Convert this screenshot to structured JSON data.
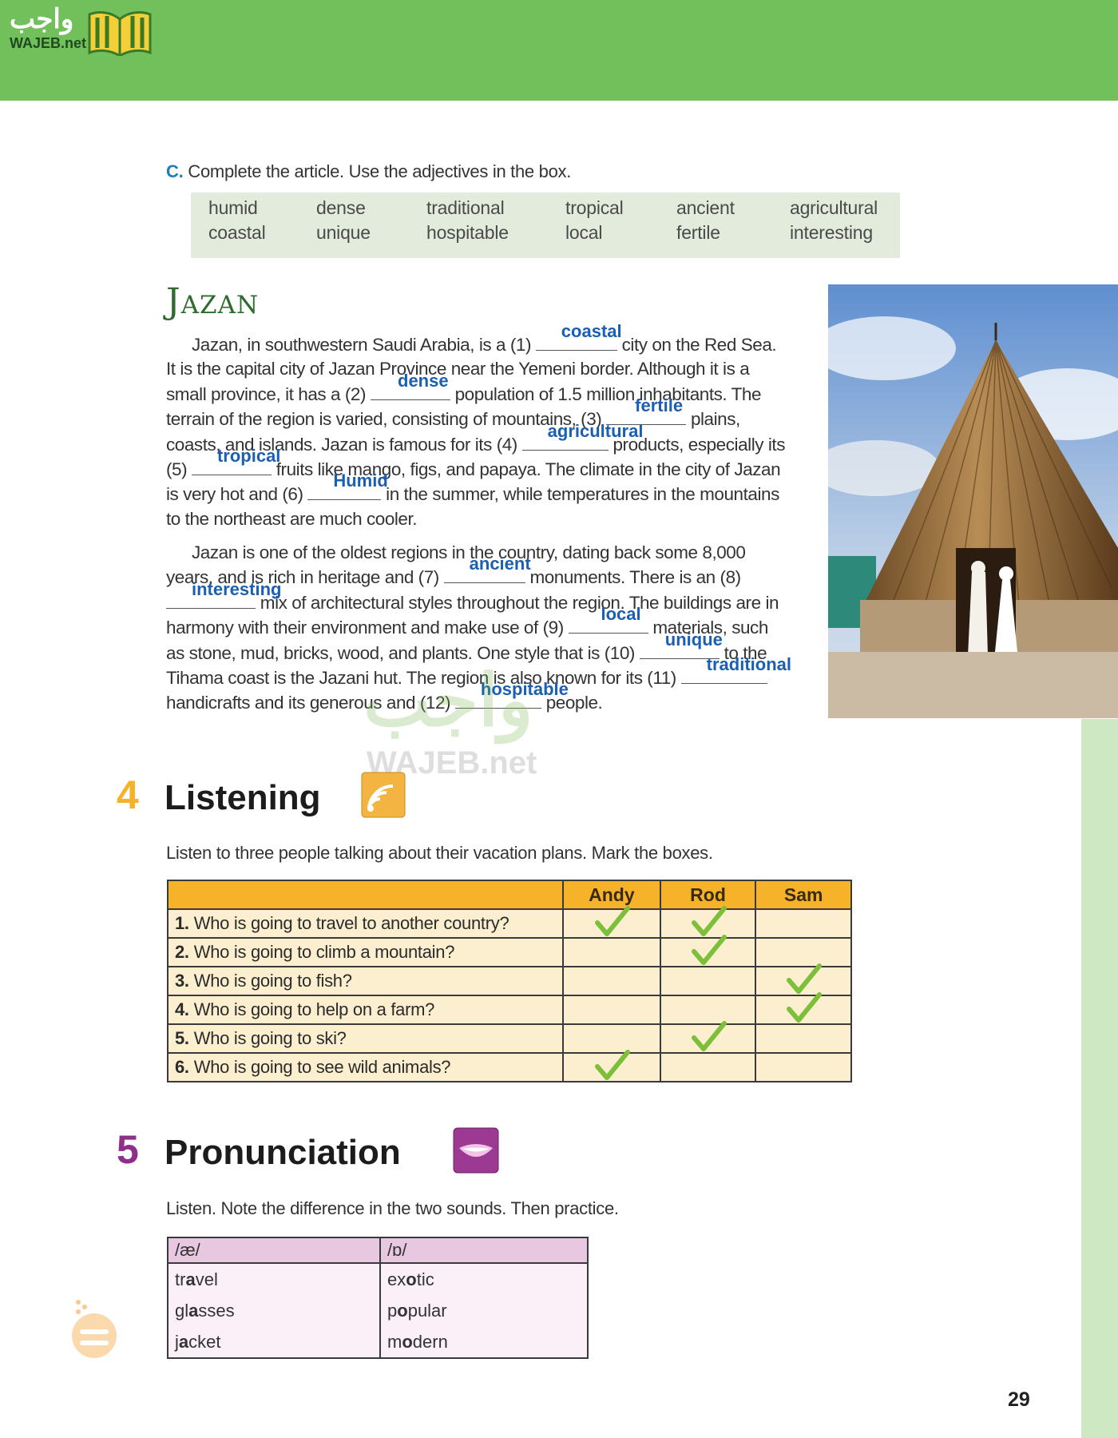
{
  "logo": {
    "arabic": "واجب",
    "english": "WAJEB.net"
  },
  "watermark": {
    "arabic": "واجب",
    "english": "WAJEB.net"
  },
  "section_c": {
    "letter": "C.",
    "instruction": "Complete the article. Use the adjectives in the box.",
    "word_box": [
      [
        "humid",
        "coastal"
      ],
      [
        "dense",
        "unique"
      ],
      [
        "traditional",
        "hospitable"
      ],
      [
        "tropical",
        "local"
      ],
      [
        "ancient",
        "fertile"
      ],
      [
        "agricultural",
        "interesting"
      ]
    ]
  },
  "article": {
    "title": "Jazan",
    "p1": {
      "t1": "Jazan, in southwestern Saudi Arabia, is a (1) ",
      "a1": "coastal",
      "t2": " city on the Red Sea. It is the capital city of Jazan Province near the Yemeni border. Although it is a small province, it has a (2) ",
      "a2": "dense",
      "t3": " population of 1.5 million inhabitants. The terrain of the region is varied, consisting of mountains, (3) ",
      "a3": "fertile",
      "t4": " plains, coasts, and islands. Jazan is famous for its (4) ",
      "a4": "agricultural",
      "t5": " products, especially its (5) ",
      "a5": "tropical",
      "t6": " fruits like mango, figs, and papaya. The climate in the city of Jazan is very hot and (6) ",
      "a6": "Humid",
      "t7": " in the summer, while temperatures in the mountains to the northeast are much cooler."
    },
    "p2": {
      "t1": "Jazan is one of the oldest regions in the country, dating back some 8,000 years, and is rich in heritage and (7) ",
      "a7": "ancient",
      "t2": " monuments. There is an (8) ",
      "a8": "interesting",
      "t3": " mix of architectural styles throughout the region. The buildings are in harmony with their environment and make use of (9) ",
      "a9": "local",
      "t4": " materials, such as stone, mud, bricks, wood, and plants. One style that is (10) ",
      "a10": "unique",
      "t5": " to the Tihama coast is the Jazani hut. The region is also known for its (11) ",
      "a11": "traditional",
      "t6": " handicrafts and its generous and (12) ",
      "a12": "hospitable",
      "t7": " people."
    }
  },
  "listening": {
    "number": "4",
    "title": "Listening",
    "instruction": "Listen to three people talking about their vacation plans. Mark the boxes.",
    "columns": [
      "Andy",
      "Rod",
      "Sam"
    ],
    "rows": [
      {
        "num": "1.",
        "question": "Who is going to travel to another country?",
        "marks": [
          true,
          true,
          false
        ]
      },
      {
        "num": "2.",
        "question": "Who is going to climb a mountain?",
        "marks": [
          false,
          true,
          false
        ]
      },
      {
        "num": "3.",
        "question": "Who is going to fish?",
        "marks": [
          false,
          false,
          true
        ]
      },
      {
        "num": "4.",
        "question": "Who is going to help on a farm?",
        "marks": [
          false,
          false,
          true
        ]
      },
      {
        "num": "5.",
        "question": "Who is going to ski?",
        "marks": [
          false,
          true,
          false
        ]
      },
      {
        "num": "6.",
        "question": "Who is going to see wild animals?",
        "marks": [
          true,
          false,
          false
        ]
      }
    ],
    "colors": {
      "header": "#f6b32a",
      "cell": "#fcefd0",
      "tick": "#7cbf3a"
    }
  },
  "pronunciation": {
    "number": "5",
    "title": "Pronunciation",
    "instruction": "Listen. Note the difference in the two sounds. Then practice.",
    "headers": [
      "/æ/",
      "/ɒ/"
    ],
    "left": [
      {
        "pre": "tr",
        "bold": "a",
        "post": "vel"
      },
      {
        "pre": "gl",
        "bold": "a",
        "post": "sses"
      },
      {
        "pre": "j",
        "bold": "a",
        "post": "cket"
      }
    ],
    "right": [
      {
        "pre": "ex",
        "bold": "o",
        "post": "tic"
      },
      {
        "pre": "p",
        "bold": "o",
        "post": "pular"
      },
      {
        "pre": "m",
        "bold": "o",
        "post": "dern"
      }
    ]
  },
  "page_number": "29",
  "colors": {
    "topbar": "#72c05c",
    "answer": "#1a5fb4",
    "listening_num": "#f6b32a",
    "pron_num": "#8e2f8a"
  }
}
